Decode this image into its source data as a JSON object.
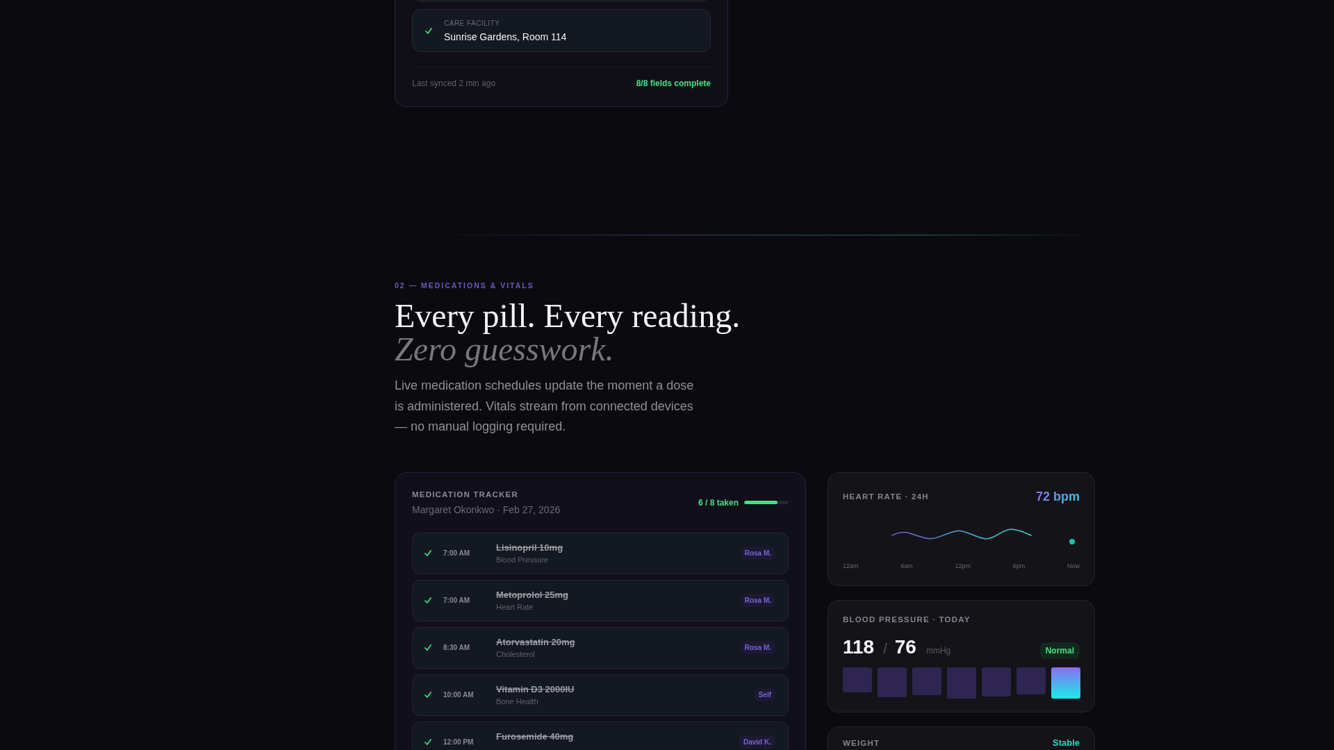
{
  "profile_card": {
    "fields": [
      {
        "label": "CARE FACILITY",
        "value": "Sunrise Gardens, Room 114",
        "complete": true
      }
    ],
    "sync_status": "Last synced 2 min ago",
    "completion": "8/8 fields complete"
  },
  "section": {
    "eyebrow": "02 — MEDICATIONS & VITALS",
    "heading": "Every pill. Every reading.",
    "heading_emphasis": "Zero guesswork.",
    "description": "Live medication schedules update the moment a dose is administered. Vitals stream from connected devices — no manual logging required."
  },
  "medication_tracker": {
    "title": "MEDICATION TRACKER",
    "subtitle": "Margaret Okonkwo · Feb 27, 2026",
    "progress": "6 / 8 taken",
    "level": 0.75,
    "doses": [
      {
        "time": "7:00 AM",
        "name": "Lisinopril 10mg",
        "purpose": "Blood Pressure",
        "given_by": "Rosa M.",
        "taken": true
      },
      {
        "time": "7:00 AM",
        "name": "Metoprolol 25mg",
        "purpose": "Heart Rate",
        "given_by": "Rosa M.",
        "taken": true
      },
      {
        "time": "8:30 AM",
        "name": "Atorvastatin 20mg",
        "purpose": "Cholesterol",
        "given_by": "Rosa M.",
        "taken": true
      },
      {
        "time": "10:00 AM",
        "name": "Vitamin D3 2000IU",
        "purpose": "Bone Health",
        "given_by": "Self",
        "taken": true
      },
      {
        "time": "12:00 PM",
        "name": "Furosemide 40mg",
        "given_by": "David K.",
        "taken": true
      }
    ]
  },
  "vitals": [
    {
      "kind": "heart_rate",
      "title": "HEART RATE · 24H",
      "value": "72 bpm",
      "axis_labels": [
        "12am",
        "6am",
        "12pm",
        "6pm",
        "Now"
      ]
    },
    {
      "kind": "blood_pressure",
      "title": "BLOOD PRESSURE · TODAY",
      "systolic": "118",
      "separator": "/",
      "diastolic": "76",
      "unit": "mmHg",
      "status": "Normal"
    },
    {
      "kind": "weight",
      "title": "WEIGHT",
      "status": "Stable"
    }
  ]
}
